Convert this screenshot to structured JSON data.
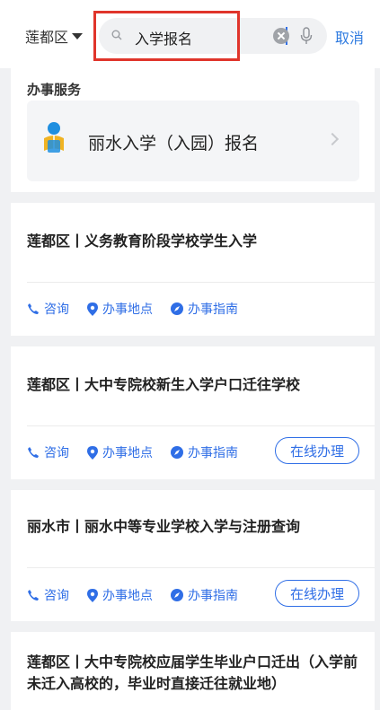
{
  "header": {
    "region": "莲都区",
    "search_text": "入学报名",
    "cancel_label": "取消"
  },
  "service": {
    "section_title": "办事服务",
    "item_label": "丽水入学（入园）报名"
  },
  "actions": {
    "consult": "咨询",
    "location": "办事地点",
    "guide": "办事指南",
    "online": "在线办理"
  },
  "results": [
    {
      "title": "莲都区丨义务教育阶段学校学生入学"
    },
    {
      "title": "莲都区丨大中专院校新生入学户口迁往学校"
    },
    {
      "title": "丽水市丨丽水中等专业学校入学与注册查询"
    },
    {
      "title": "莲都区丨大中专院校应届学生毕业户口迁出（入学前未迁入高校的，毕业时直接迁往就业地）"
    }
  ],
  "colors": {
    "accent": "#2f6ee6",
    "highlight": "#e0352b"
  }
}
